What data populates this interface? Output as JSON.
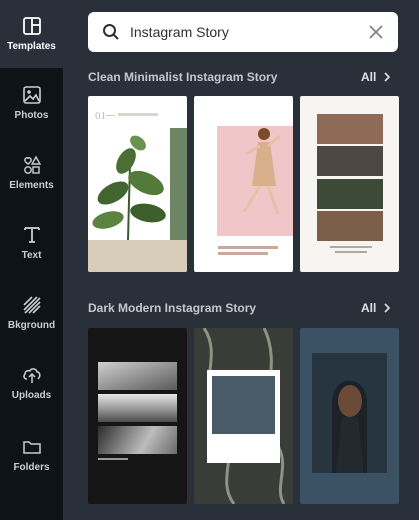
{
  "sidebar": {
    "items": [
      {
        "label": "Templates",
        "icon": "templates-icon",
        "active": true
      },
      {
        "label": "Photos",
        "icon": "photos-icon",
        "active": false
      },
      {
        "label": "Elements",
        "icon": "elements-icon",
        "active": false
      },
      {
        "label": "Text",
        "icon": "text-icon",
        "active": false
      },
      {
        "label": "Bkground",
        "icon": "background-icon",
        "active": false
      },
      {
        "label": "Uploads",
        "icon": "uploads-icon",
        "active": false
      },
      {
        "label": "Folders",
        "icon": "folders-icon",
        "active": false
      }
    ]
  },
  "search": {
    "value": "Instagram Story"
  },
  "sections": [
    {
      "title": "Clean Minimalist Instagram Story",
      "all_label": "All"
    },
    {
      "title": "Dark Modern Instagram Story",
      "all_label": "All"
    }
  ],
  "thumbs": {
    "t1": {
      "number": "01"
    }
  },
  "colors": {
    "sidebar_bg": "#0e1318",
    "panel_bg": "#293039",
    "search_bg": "#ffffff"
  }
}
